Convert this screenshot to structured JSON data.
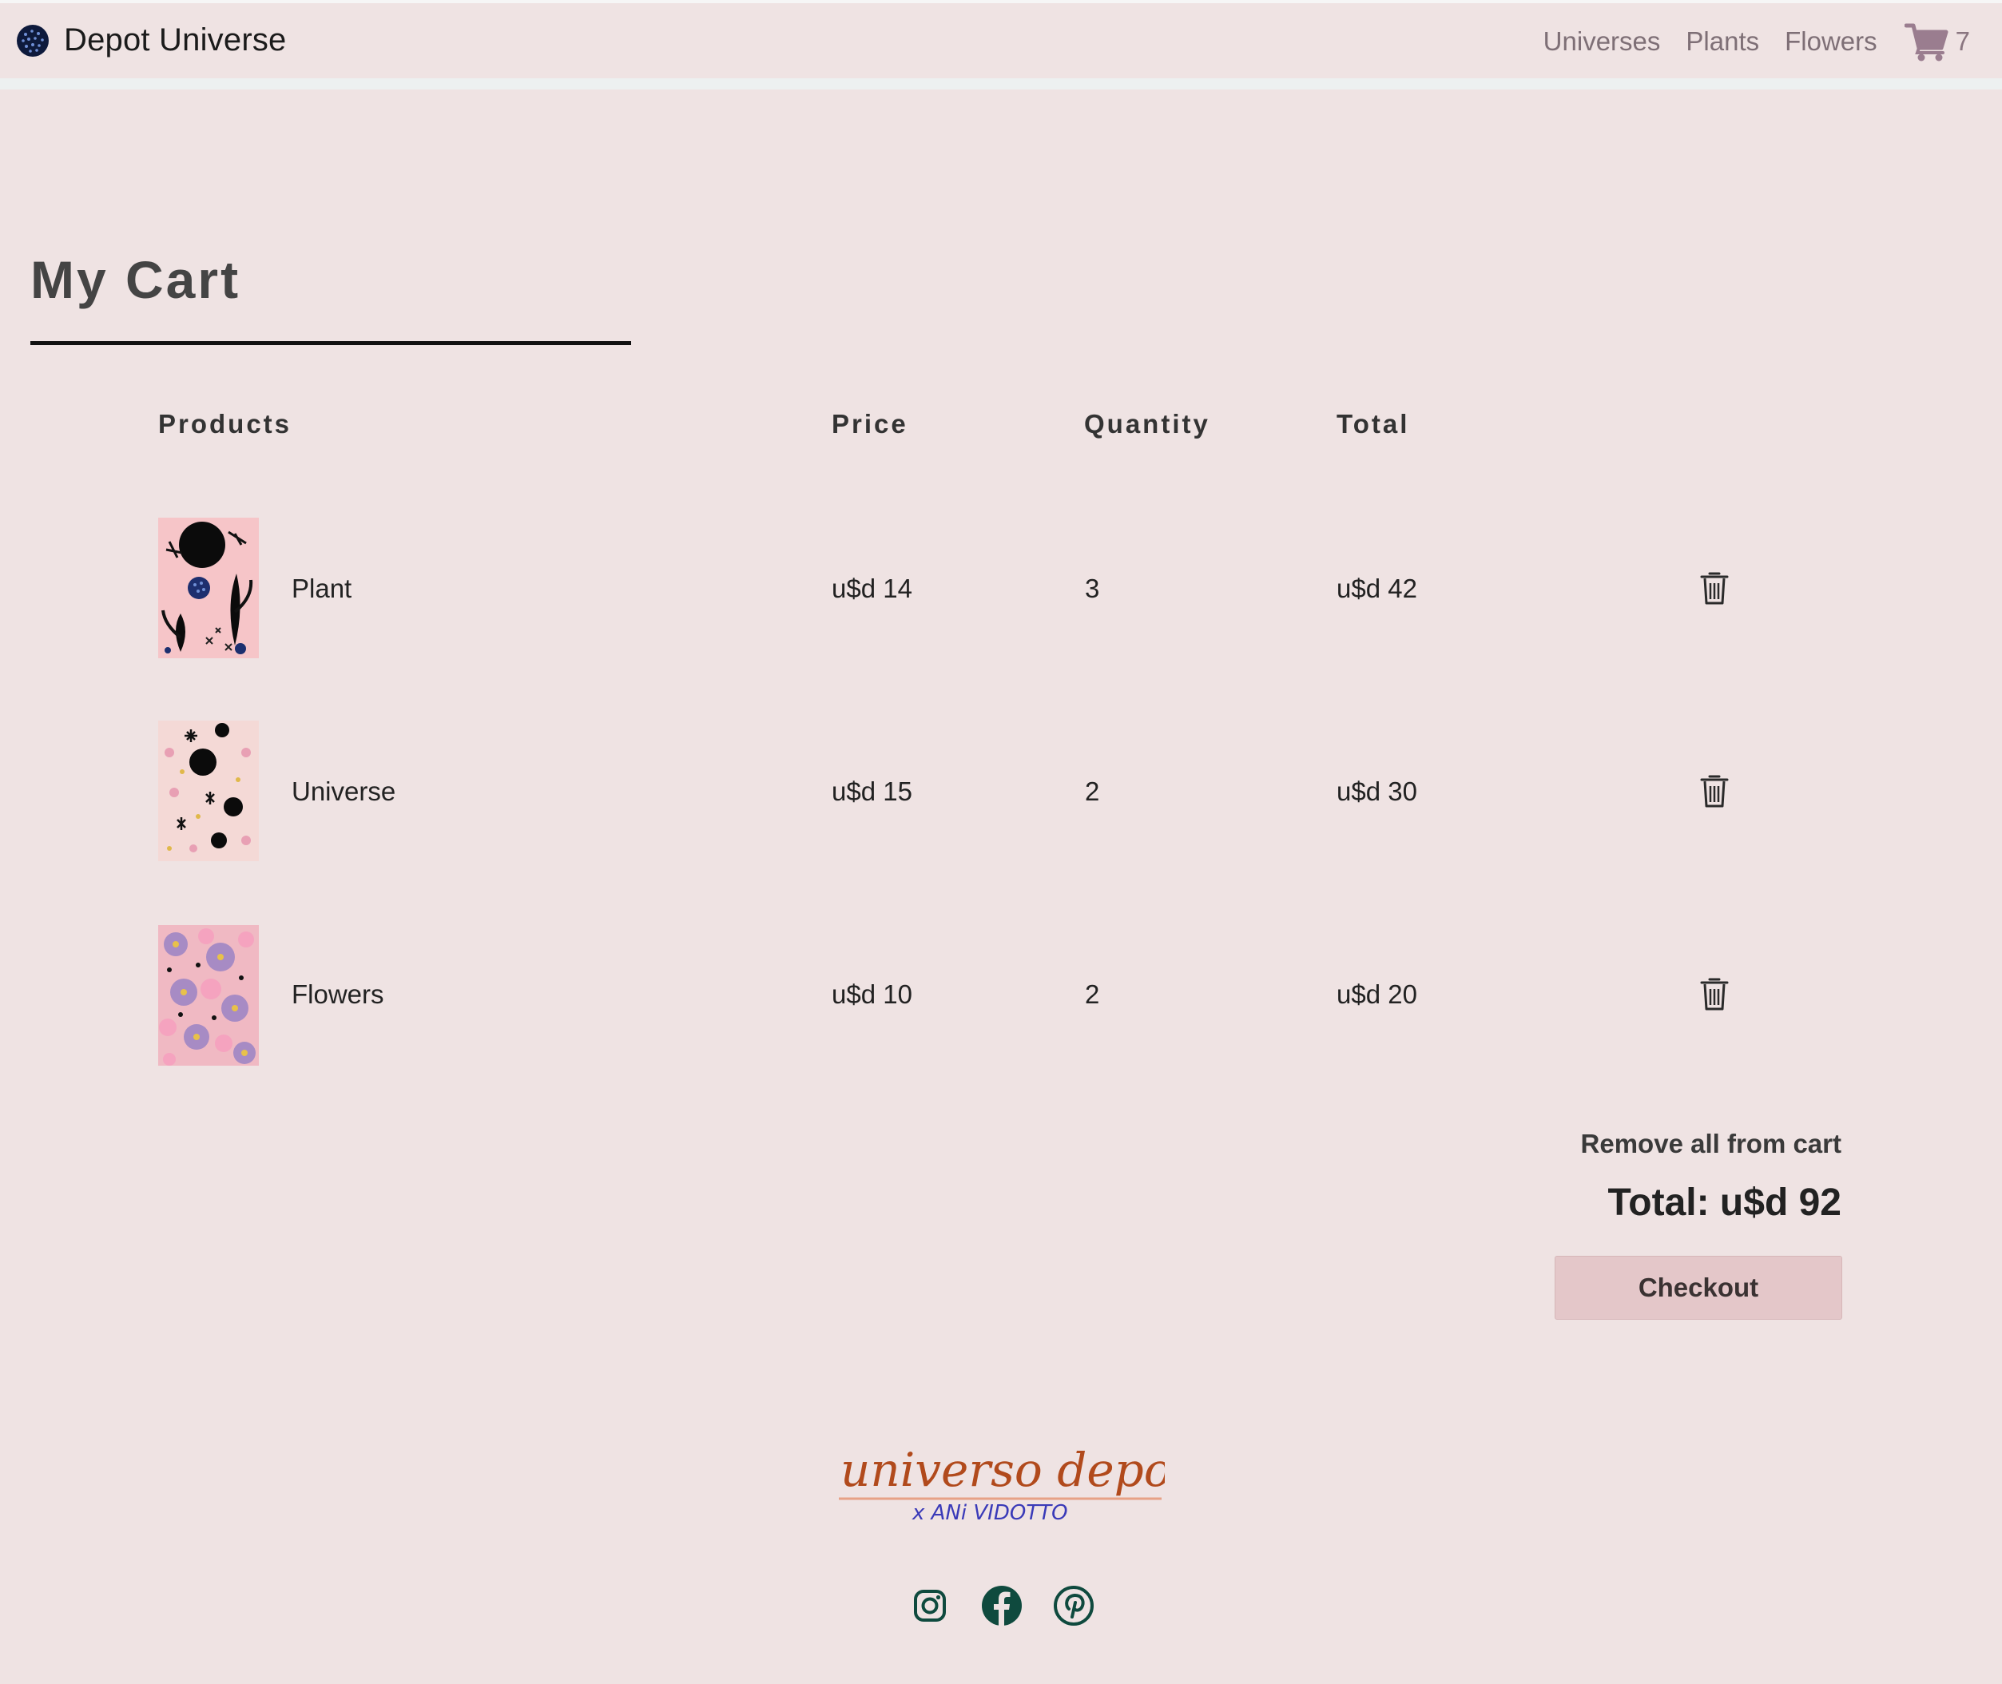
{
  "brand": {
    "name": "Depot Universe",
    "logo_icon": "galaxy-logo-icon"
  },
  "nav": {
    "links": [
      "Universes",
      "Plants",
      "Flowers"
    ],
    "cart_icon": "shopping-cart-icon",
    "cart_count": "7"
  },
  "page": {
    "title": "My Cart"
  },
  "table": {
    "headers": {
      "products": "Products",
      "price": "Price",
      "quantity": "Quantity",
      "total": "Total"
    },
    "rows": [
      {
        "name": "Plant",
        "price": "u$d 14",
        "quantity": "3",
        "total": "u$d 42",
        "thumb": "plant-pattern-thumbnail"
      },
      {
        "name": "Universe",
        "price": "u$d 15",
        "quantity": "2",
        "total": "u$d 30",
        "thumb": "universe-pattern-thumbnail"
      },
      {
        "name": "Flowers",
        "price": "u$d 10",
        "quantity": "2",
        "total": "u$d 20",
        "thumb": "flowers-pattern-thumbnail"
      }
    ],
    "delete_icon": "trash-icon"
  },
  "summary": {
    "remove_all": "Remove all from cart",
    "total": "Total: u$d 92",
    "checkout": "Checkout"
  },
  "footer": {
    "logo_text": "universo depot",
    "logo_subtext": "x ANi VIDOTTO",
    "socials": [
      "instagram-icon",
      "facebook-icon",
      "pinterest-icon"
    ]
  },
  "colors": {
    "background": "#efe3e3",
    "nav_link": "#7e6f76",
    "cart_icon": "#9a7d8f",
    "checkout_bg": "#e4c7c9",
    "logo_brown": "#b14a1c",
    "logo_blue": "#3a3ab8",
    "social_green": "#0f4a3e"
  }
}
